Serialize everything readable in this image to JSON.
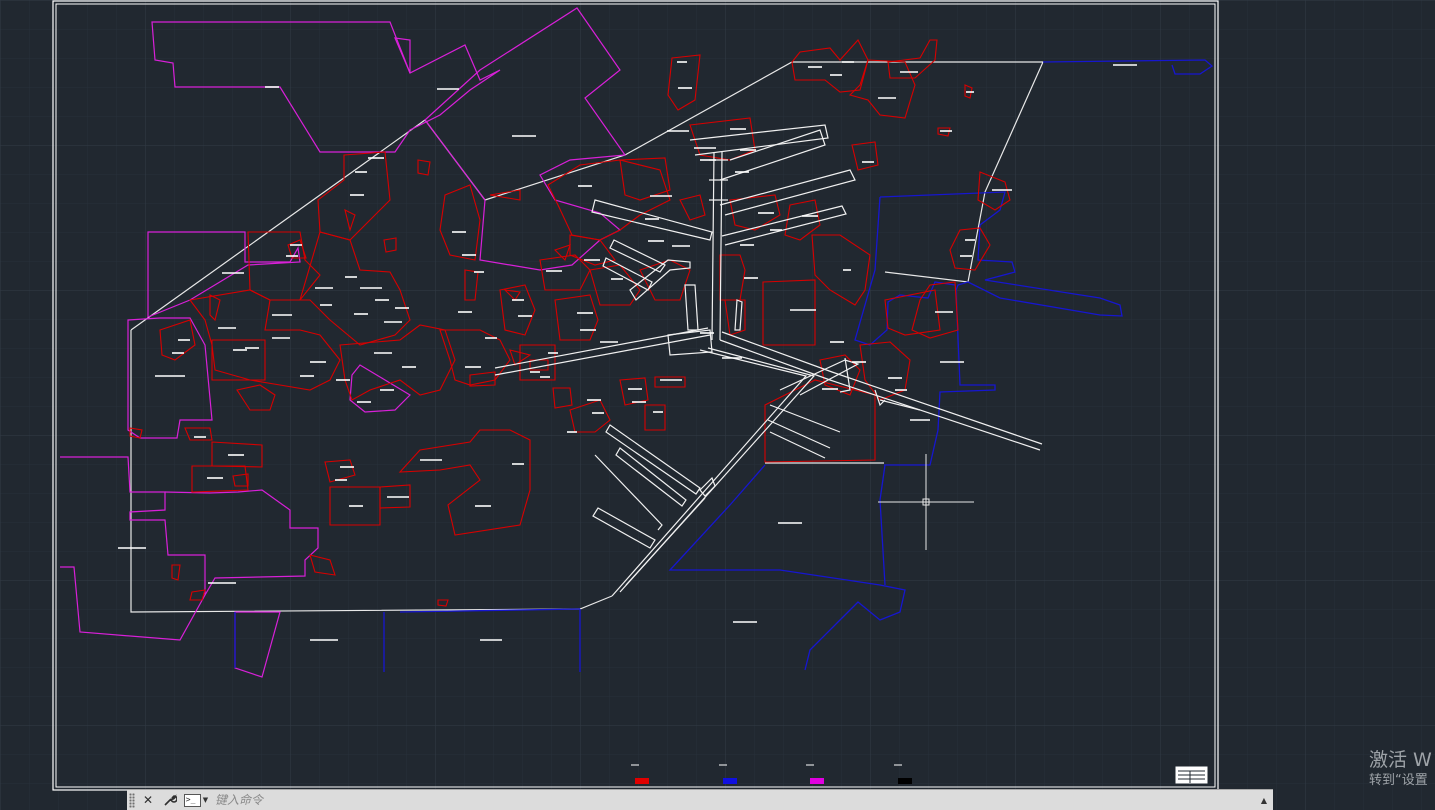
{
  "app": {
    "theme_colors": {
      "background": "#212830",
      "grid": "#2c343e",
      "frame": "#ffffff",
      "layer_red": "#e00000",
      "layer_magenta": "#e020e0",
      "layer_blue": "#1414d8",
      "layer_white": "#ffffff"
    }
  },
  "legend": {
    "swatches": [
      {
        "color": "#e00000"
      },
      {
        "color": "#1010e0"
      },
      {
        "color": "#e000e0"
      },
      {
        "color": "#000000"
      }
    ]
  },
  "command_line": {
    "placeholder": "键入命令",
    "close_icon": "close-icon",
    "customize_icon": "wrench-icon",
    "prompt_icon": "command-prompt-icon",
    "history_icon": "chevron-up-icon"
  },
  "watermark": {
    "line1": "激活 W",
    "line2": "转到“设置"
  }
}
